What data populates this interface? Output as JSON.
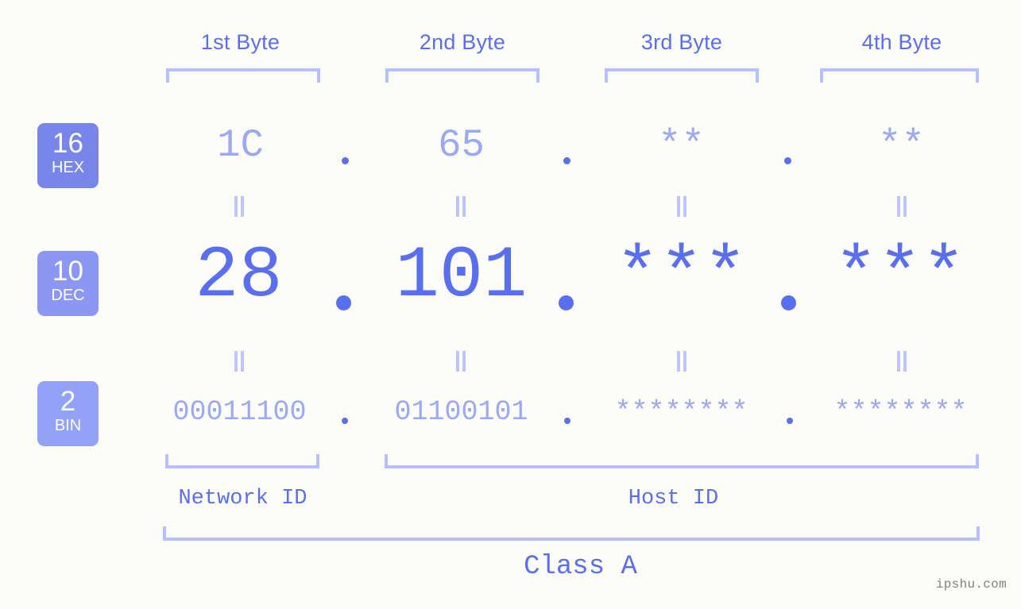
{
  "meta": {
    "background_color": "#fcfdf8",
    "accent_color": "#5a6ef0",
    "accent_light_color": "#9aa8f5",
    "bracket_color": "#b6bfff",
    "watermark": "ipshu.com"
  },
  "byte_headers": [
    {
      "label": "1st Byte"
    },
    {
      "label": "2nd Byte"
    },
    {
      "label": "3rd Byte"
    },
    {
      "label": "4th Byte"
    }
  ],
  "rows": [
    {
      "badge": {
        "number": "16",
        "name": "HEX",
        "color": "#7886ec"
      },
      "values": [
        "1C",
        "65",
        "**",
        "**"
      ]
    },
    {
      "badge": {
        "number": "10",
        "name": "DEC",
        "color": "#8b97f2"
      },
      "values": [
        "28",
        "101",
        "***",
        "***"
      ]
    },
    {
      "badge": {
        "number": "2",
        "name": "BIN",
        "color": "#93a1f6"
      },
      "values": [
        "00011100",
        "01100101",
        "********",
        "********"
      ]
    }
  ],
  "separators": {
    "dot": "."
  },
  "equals_marker": "=",
  "sections": [
    {
      "label": "Network ID"
    },
    {
      "label": "Host ID"
    }
  ],
  "class": {
    "label": "Class A"
  }
}
